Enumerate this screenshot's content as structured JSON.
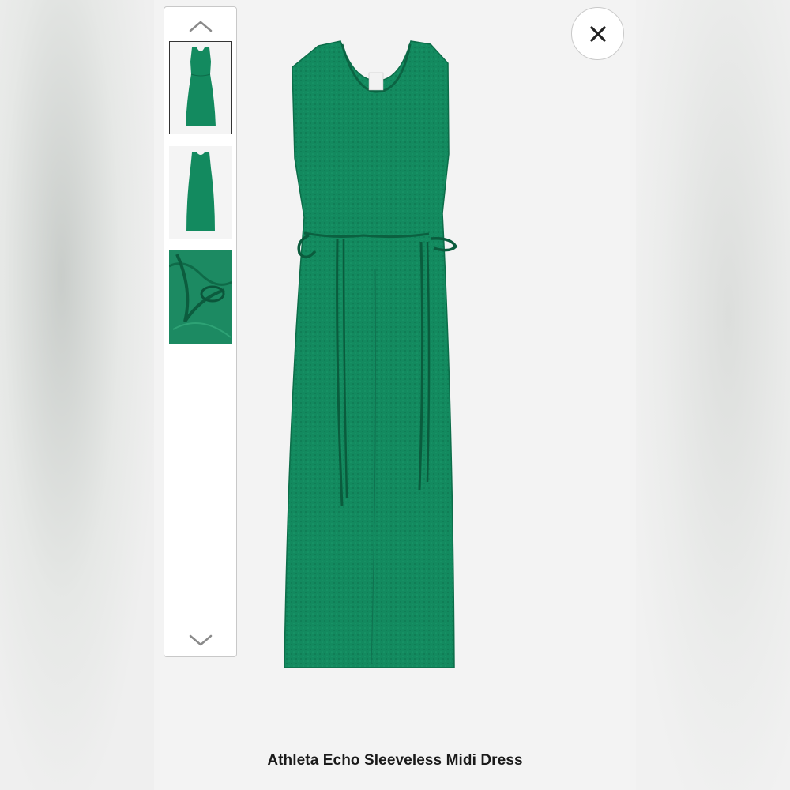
{
  "product": {
    "title": "Athleta Echo Sleeveless Midi Dress",
    "color_hex": "#138a5f"
  },
  "gallery": {
    "thumbnails": [
      {
        "name": "front-view",
        "selected": true
      },
      {
        "name": "back-view",
        "selected": false
      },
      {
        "name": "detail-view",
        "selected": false
      }
    ],
    "up_icon": "chevron-up-icon",
    "down_icon": "chevron-down-icon"
  },
  "close_icon": "close-icon"
}
